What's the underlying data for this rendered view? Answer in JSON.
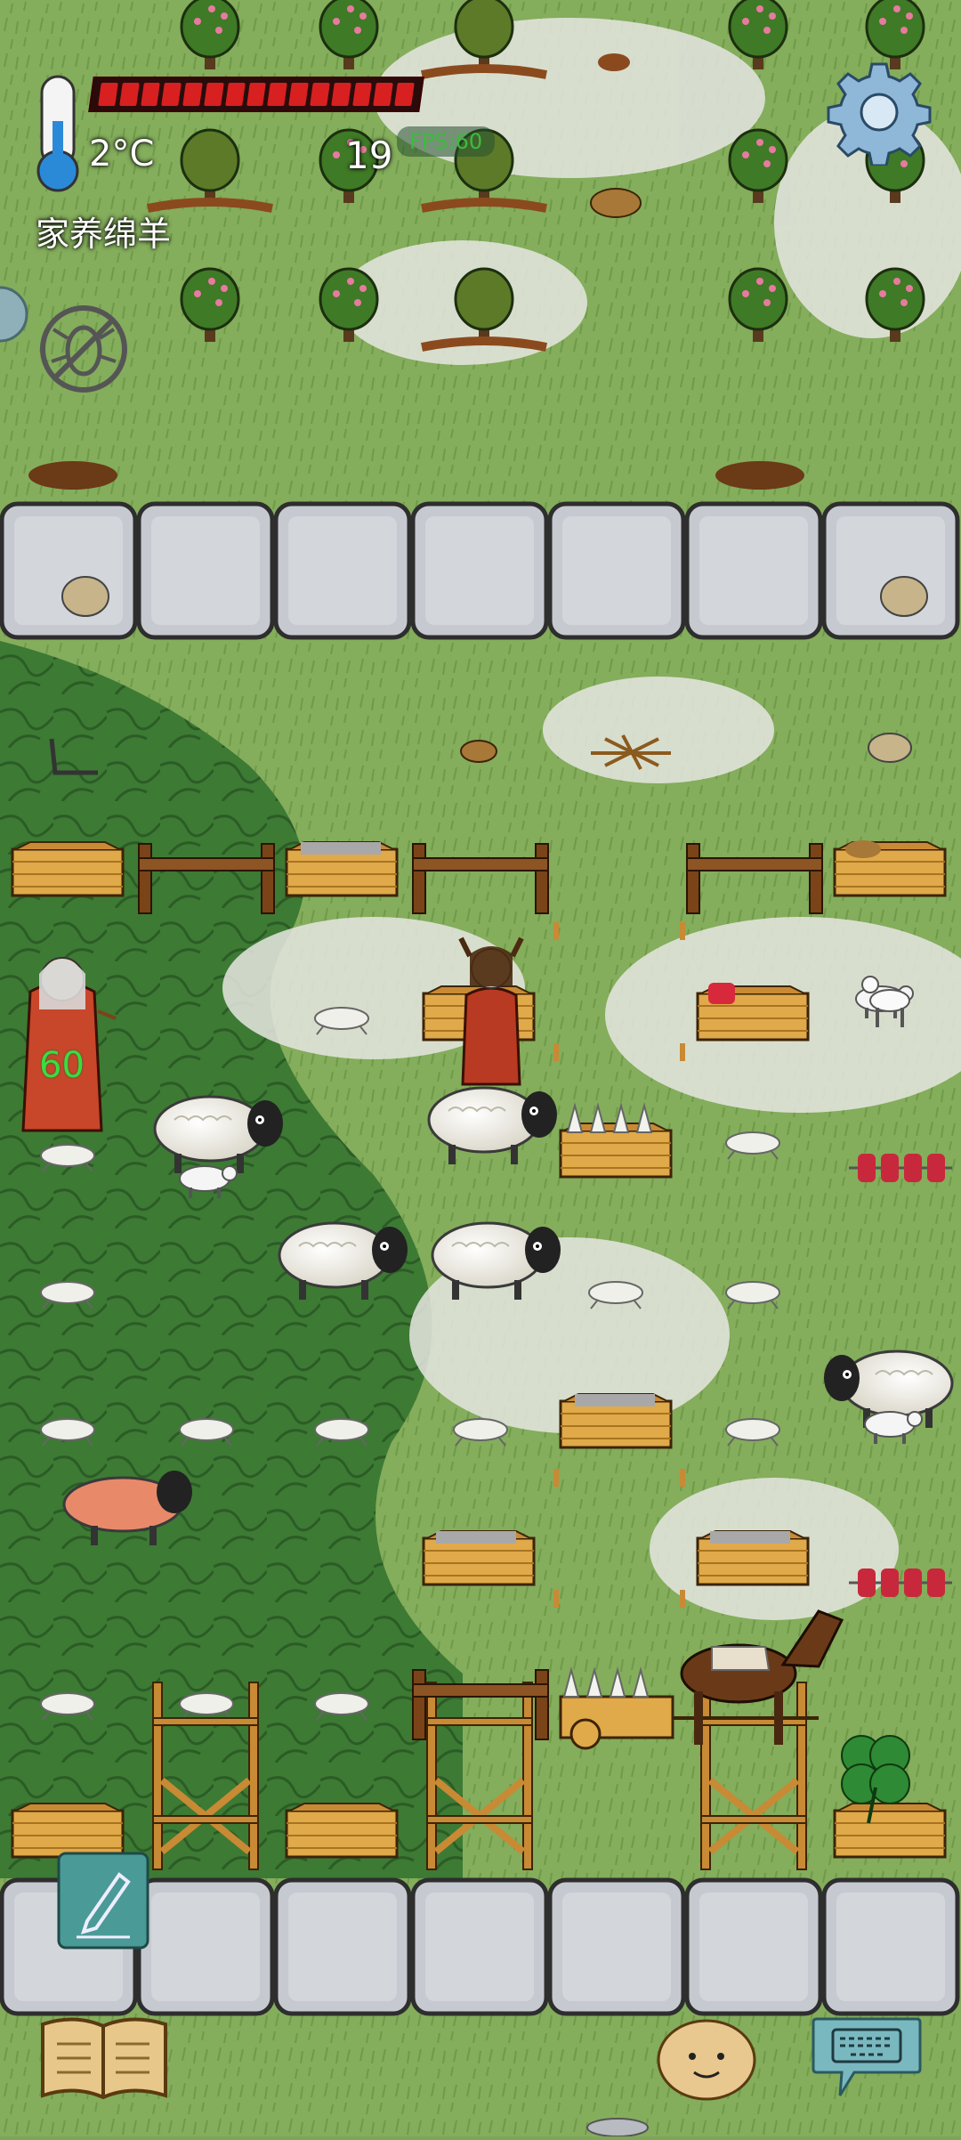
{
  "hud": {
    "temperature": "2°C",
    "food_count": "19",
    "fps": "FPS:60",
    "status_label": "家养绵羊",
    "health_segments": 15,
    "health_fraction": 1.0,
    "player_age": "60"
  },
  "icons": {
    "thermometer": "thermometer-icon",
    "settings": "gear-icon",
    "no_bugs": "no-bug-icon",
    "notes": "pencil-note-icon",
    "tech_book": "open-book-icon",
    "emote": "potato-face-icon",
    "chat": "keyboard-speech-icon"
  },
  "colors": {
    "grass": "#7fa55a",
    "dark_grass": "#3f7a35",
    "stone": "#c9cdd3",
    "health_red": "#d82020",
    "fps_green": "#3dbb3d"
  }
}
